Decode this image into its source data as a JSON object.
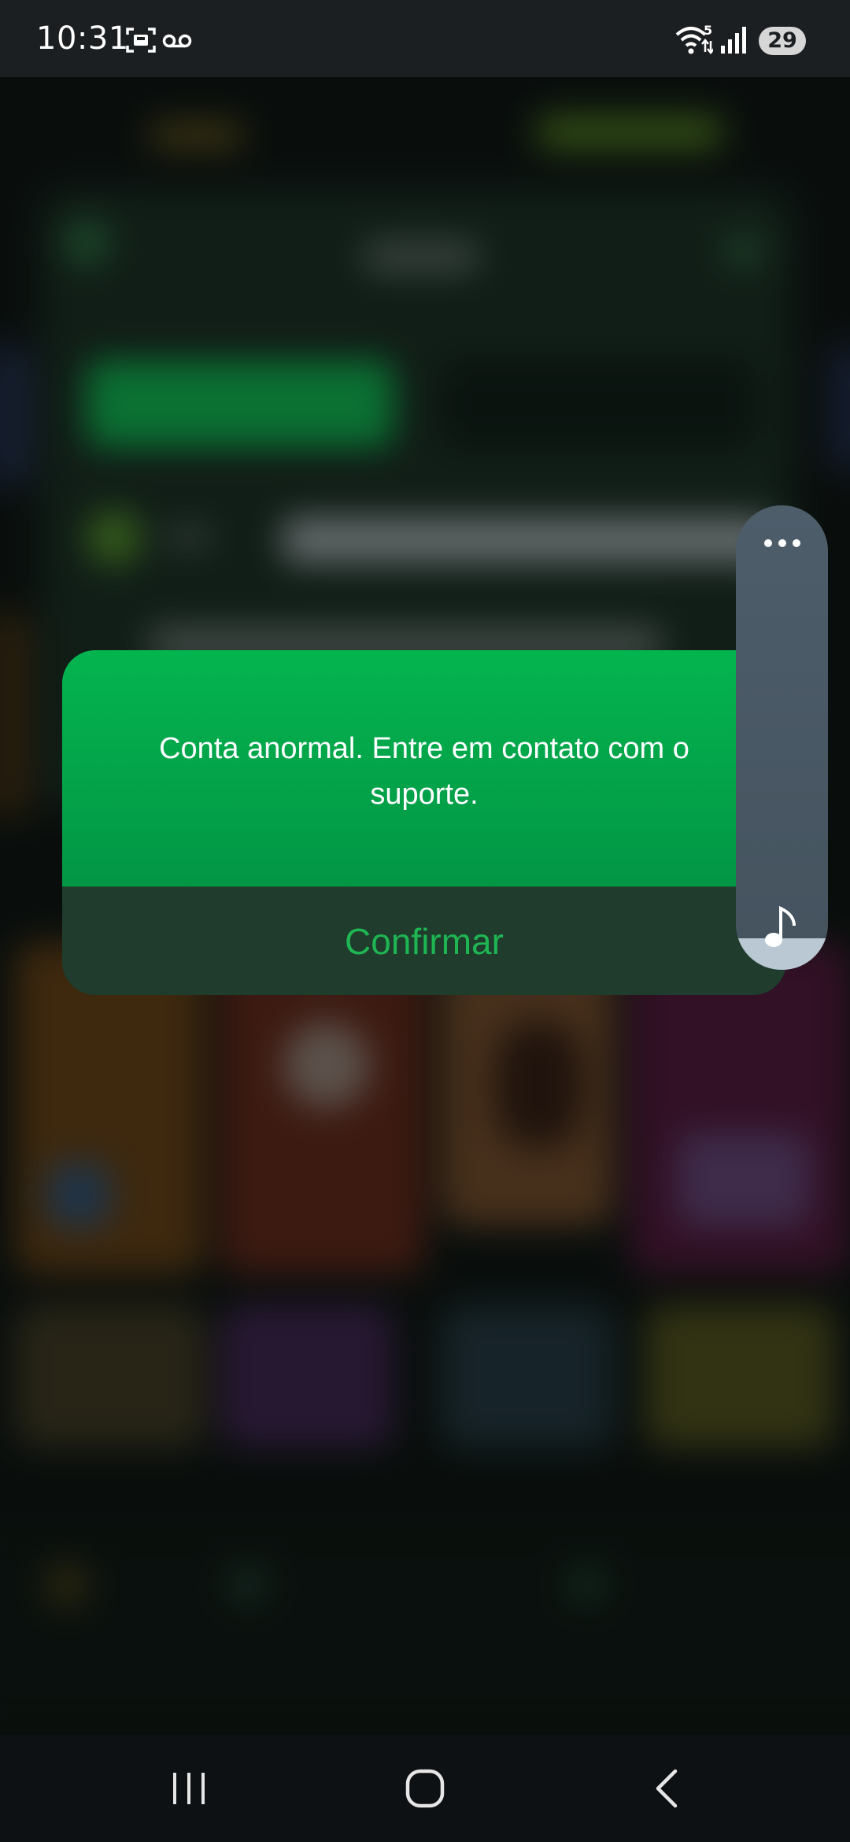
{
  "status_bar": {
    "time": "10:31",
    "battery": "29",
    "network_badge": "5",
    "icons": [
      "screenshot-icon",
      "voicemail-icon",
      "wifi-icon",
      "signal-icon",
      "battery-icon"
    ]
  },
  "dialog": {
    "message": "Conta anormal. Entre em contato com o suporte.",
    "confirm_label": "Confirmar",
    "colors": {
      "header_top": "#04b44f",
      "header_bottom": "#029645",
      "footer": "#1f3c2d",
      "confirm_text": "#1fb553"
    }
  },
  "side_panel": {
    "icons": [
      "more-icon",
      "music-note-icon"
    ]
  },
  "nav_bar": {
    "icons": [
      "recent-apps-icon",
      "home-icon",
      "back-icon"
    ]
  }
}
